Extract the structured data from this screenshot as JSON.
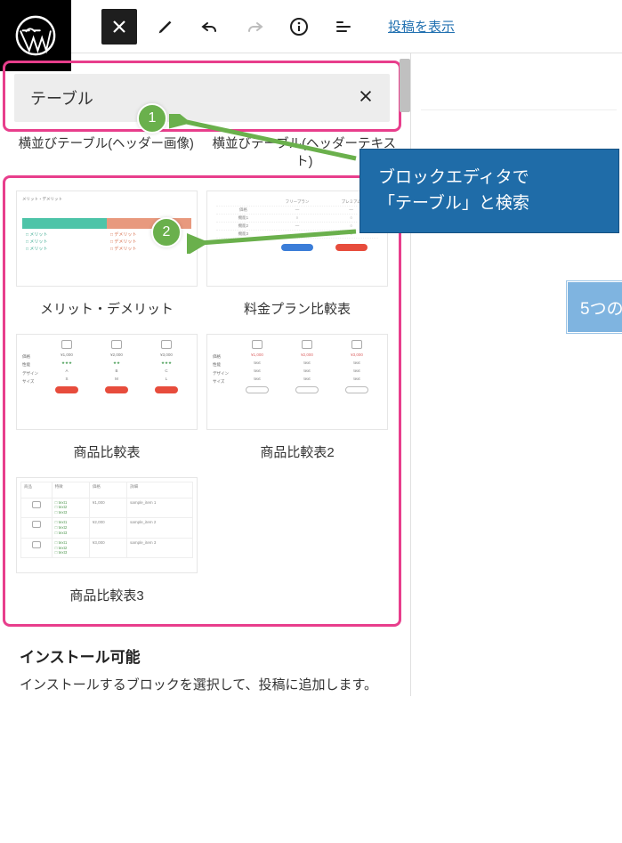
{
  "toolbar": {
    "view_post": "投稿を表示"
  },
  "search": {
    "value": "テーブル"
  },
  "block_titles": {
    "left": "横並びテーブル(ヘッダー画像)",
    "right": "横並びテーブル(ヘッダーテキスト)"
  },
  "patterns": [
    {
      "label": "メリット・デメリット"
    },
    {
      "label": "料金プラン比較表"
    },
    {
      "label": "商品比較表"
    },
    {
      "label": "商品比較表2"
    },
    {
      "label": "商品比較表3"
    }
  ],
  "install": {
    "title": "インストール可能",
    "desc": "インストールするブロックを選択して、投稿に追加します。"
  },
  "callout": {
    "line1": "ブロックエディタで",
    "line2": "「テーブル」と検索"
  },
  "callout2": "5つの",
  "markers": {
    "one": "1",
    "two": "2"
  }
}
